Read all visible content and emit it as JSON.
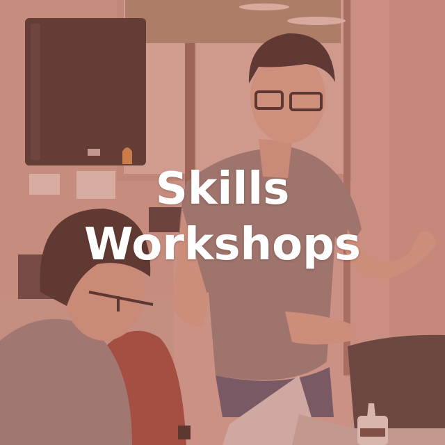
{
  "tile": {
    "title_line1": "Skills",
    "title_line2": "Workshops"
  },
  "colors": {
    "overlay": "#b56b5c",
    "title": "#ffffff"
  }
}
